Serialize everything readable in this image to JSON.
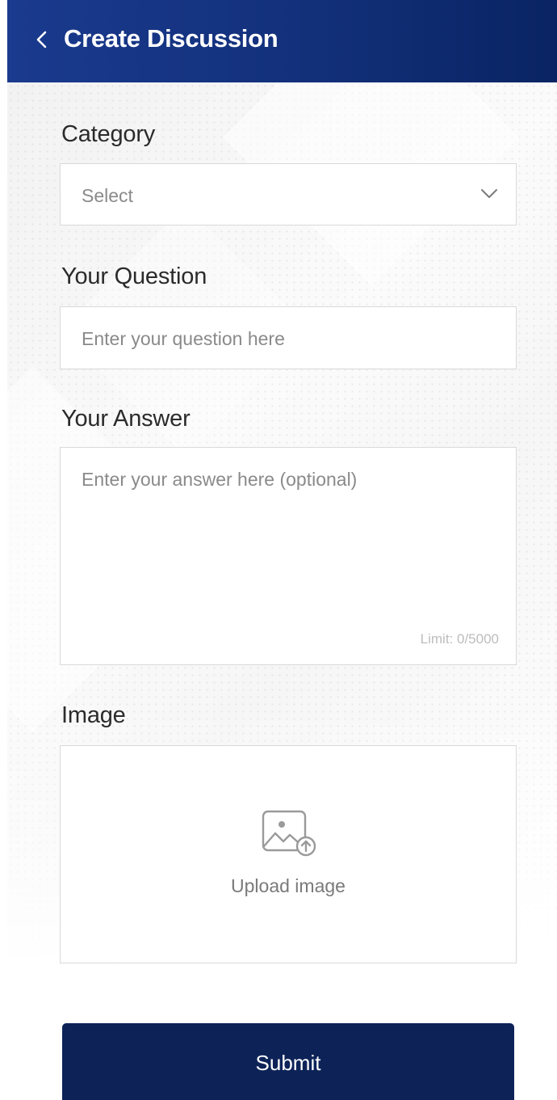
{
  "header": {
    "title": "Create Discussion",
    "back_icon": "chevron-left-icon",
    "colors": {
      "start": "#1a3a8e",
      "end": "#0a2463"
    }
  },
  "form": {
    "category": {
      "label": "Category",
      "selected": "Select",
      "icon": "chevron-down-icon"
    },
    "question": {
      "label": "Your Question",
      "placeholder": "Enter your question here"
    },
    "answer": {
      "label": "Your Answer",
      "placeholder": "Enter your answer here (optional)",
      "limit_text": "Limit: 0/5000"
    },
    "image": {
      "label": "Image",
      "upload_label": "Upload image",
      "icon": "image-upload-icon"
    }
  },
  "submit": {
    "label": "Submit",
    "color": "#0d2358"
  }
}
